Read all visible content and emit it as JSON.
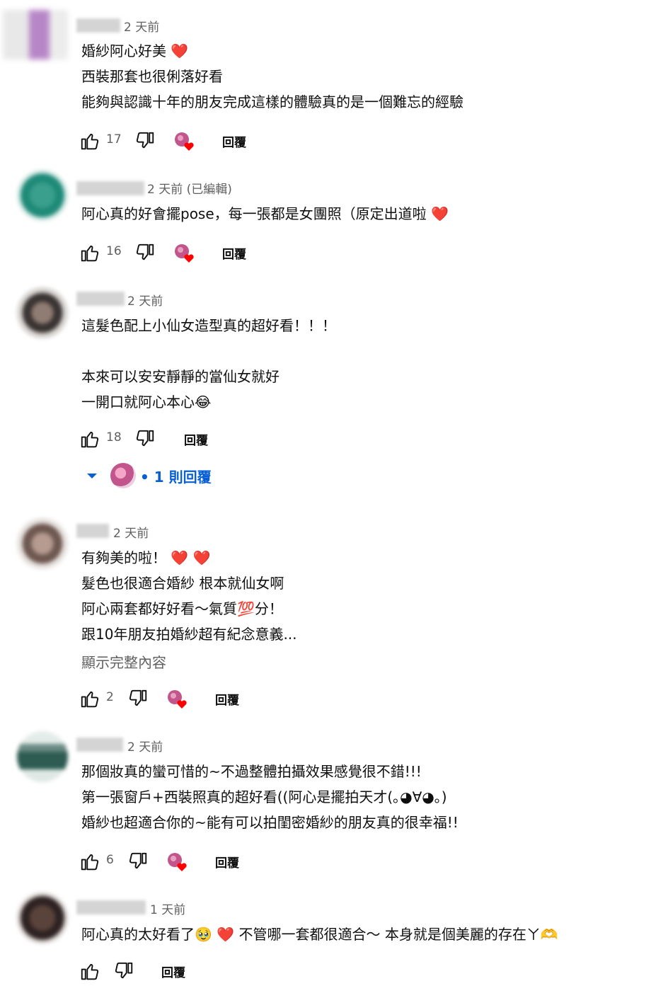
{
  "comments": [
    {
      "time": "2 天前",
      "lines": [
        "婚紗阿心好美 ❤️",
        "西裝那套也很俐落好看",
        "能夠與認識十年的朋友完成這樣的體驗真的是一個難忘的經驗"
      ],
      "likes": "17",
      "reply_label": "回覆",
      "creator_heart": true
    },
    {
      "time": "2 天前 (已編輯)",
      "lines": [
        "阿心真的好會擺pose，每一張都是女團照（原定出道啦 ❤️"
      ],
      "likes": "16",
      "reply_label": "回覆",
      "creator_heart": true
    },
    {
      "time": "2 天前",
      "lines": [
        "這髮色配上小仙女造型真的超好看！！！",
        "",
        "本來可以安安靜靜的當仙女就好",
        "一開口就阿心本心😂"
      ],
      "likes": "18",
      "reply_label": "回覆",
      "creator_heart": false,
      "replies_label": "• 1 則回覆"
    },
    {
      "time": "2 天前",
      "lines": [
        "有夠美的啦！ ❤️ ❤️",
        "髮色也很適合婚紗 根本就仙女啊",
        "阿心兩套都好好看～氣質💯分！",
        "跟10年朋友拍婚紗超有紀念意義..."
      ],
      "show_more": "顯示完整內容",
      "likes": "2",
      "reply_label": "回覆",
      "creator_heart": true
    },
    {
      "time": "2 天前",
      "lines": [
        "那個妝真的蠻可惜的~不過整體拍攝效果感覺很不錯!!!",
        "第一張窗戶+西裝照真的超好看((阿心是擺拍天才(｡◕∀◕｡)",
        "婚紗也超適合你的~能有可以拍閨密婚紗的朋友真的很幸福!!"
      ],
      "likes": "6",
      "reply_label": "回覆",
      "creator_heart": true
    },
    {
      "time": "1 天前",
      "lines": [
        "阿心真的太好看了🥹 ❤️ 不管哪一套都很適合～ 本身就是個美麗的存在ㄚ🫶"
      ],
      "likes": "",
      "reply_label": "回覆",
      "creator_heart": false
    }
  ],
  "colors": {
    "link": "#065fd4",
    "meta": "#606060",
    "text": "#0f0f0f",
    "heart": "#ff0000"
  },
  "icons": [
    "thumb-up-icon",
    "thumb-down-icon",
    "creator-heart-icon",
    "chevron-down-icon"
  ]
}
